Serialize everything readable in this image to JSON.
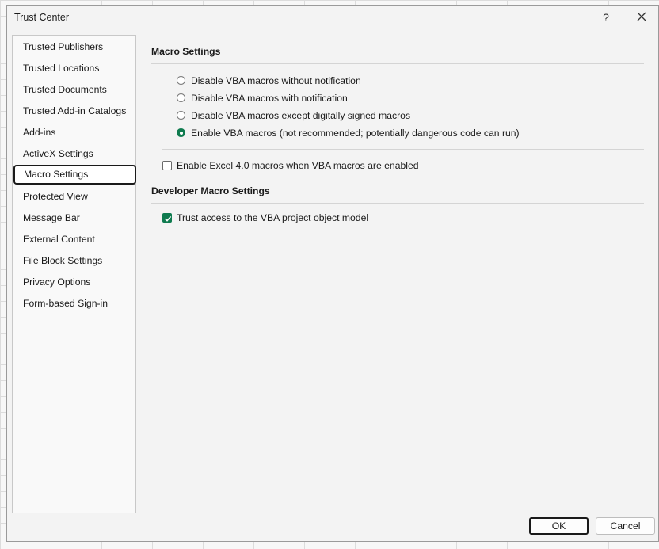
{
  "window": {
    "title": "Trust Center",
    "help_label": "?",
    "close_icon": "close-icon"
  },
  "sidebar": {
    "items": [
      {
        "label": "Trusted Publishers"
      },
      {
        "label": "Trusted Locations"
      },
      {
        "label": "Trusted Documents"
      },
      {
        "label": "Trusted Add-in Catalogs"
      },
      {
        "label": "Add-ins"
      },
      {
        "label": "ActiveX Settings"
      },
      {
        "label": "Macro Settings",
        "selected": true
      },
      {
        "label": "Protected View"
      },
      {
        "label": "Message Bar"
      },
      {
        "label": "External Content"
      },
      {
        "label": "File Block Settings"
      },
      {
        "label": "Privacy Options"
      },
      {
        "label": "Form-based Sign-in"
      }
    ]
  },
  "macro_settings": {
    "title": "Macro Settings",
    "options": [
      {
        "label": "Disable VBA macros without notification",
        "checked": false
      },
      {
        "label": "Disable VBA macros with notification",
        "checked": false
      },
      {
        "label": "Disable VBA macros except digitally signed macros",
        "checked": false
      },
      {
        "label": "Enable VBA macros (not recommended; potentially dangerous code can run)",
        "checked": true
      }
    ],
    "excel4_label": "Enable Excel 4.0 macros when VBA macros are enabled",
    "excel4_checked": false
  },
  "developer_settings": {
    "title": "Developer Macro Settings",
    "trust_vba_label": "Trust access to the VBA project object model",
    "trust_vba_checked": true
  },
  "buttons": {
    "ok": "OK",
    "cancel": "Cancel"
  },
  "colors": {
    "accent": "#0f7b4f",
    "dialog_bg": "#f3f3f3",
    "selected_border": "#1a1a1a"
  }
}
